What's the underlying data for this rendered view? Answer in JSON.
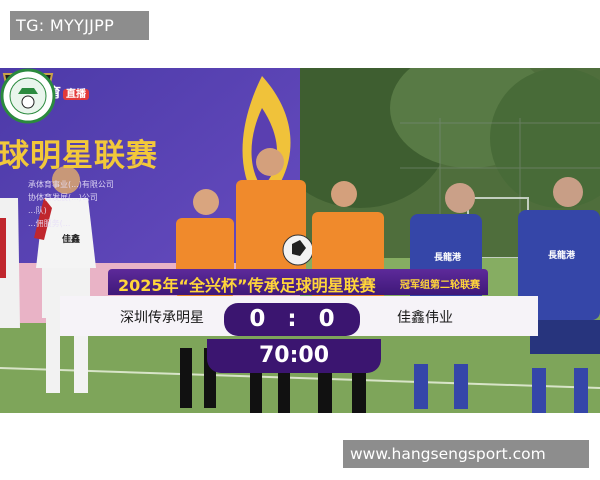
{
  "watermark_top": "TG: MYYJJPP",
  "watermark_bottom": "www.hangsengsport.com",
  "banner": {
    "brand": "讯体育",
    "brand_badge": "直播",
    "title": "球明星联赛",
    "lines": [
      "承体育事业(...)有限公司",
      "协体育发展(...)公司",
      "...队)",
      "...佣服务(..."
    ]
  },
  "scoreboard": {
    "title": "2025年“全兴杯”传承足球明星联赛",
    "subtitle": "冠军组第二轮联赛",
    "home_team": "深圳传承明星",
    "away_team": "佳鑫伟业",
    "home_score": "0",
    "separator": ":",
    "away_score": "0",
    "clock": "70:00"
  },
  "jersey_text": {
    "left_player": "佳鑫",
    "blue_players": "長龍港"
  },
  "colors": {
    "banner_purple": "#5a3fb0",
    "scoreboard_purple": "#3b1570",
    "title_yellow": "#ffd53a",
    "orange_kit": "#f08a2c",
    "blue_kit": "#3546a8",
    "grass": "#7ea55a"
  }
}
